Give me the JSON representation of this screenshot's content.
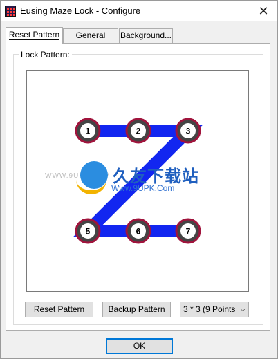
{
  "window": {
    "title": "Eusing Maze Lock - Configure",
    "close_glyph": "✕"
  },
  "tabs": [
    {
      "label": "Reset Pattern",
      "active": true
    },
    {
      "label": "General",
      "active": false
    },
    {
      "label": "Background...",
      "active": false
    }
  ],
  "lock_pattern": {
    "group_label": "Lock Pattern:",
    "grid": "3x3",
    "points": [
      {
        "label": "1",
        "row": 1,
        "col": 1
      },
      {
        "label": "2",
        "row": 1,
        "col": 2
      },
      {
        "label": "3",
        "row": 1,
        "col": 3
      },
      {
        "label": "5",
        "row": 3,
        "col": 1
      },
      {
        "label": "6",
        "row": 3,
        "col": 2
      },
      {
        "label": "7",
        "row": 3,
        "col": 3
      }
    ],
    "path_order": [
      "1",
      "2",
      "3",
      "5",
      "6",
      "7"
    ],
    "line_color": "#1226f0",
    "ring_color": "#a0143c"
  },
  "watermark": {
    "left_text": "WWW.9UPK.COM",
    "cn_text": "久友下载站",
    "url_text": "Www.9UPK.Com"
  },
  "buttons": {
    "reset": "Reset Pattern",
    "backup": "Backup Pattern",
    "ok": "OK"
  },
  "grid_select": {
    "value": "3 * 3 (9 Points",
    "arrow": "⌵"
  }
}
